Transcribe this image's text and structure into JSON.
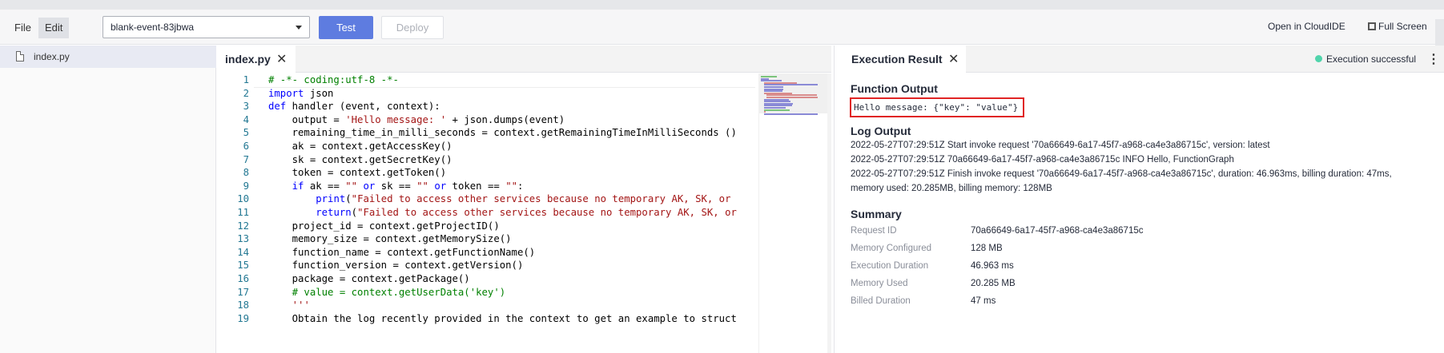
{
  "toolbar": {
    "menu_file": "File",
    "menu_edit": "Edit",
    "function_select_value": "blank-event-83jbwa",
    "test_label": "Test",
    "deploy_label": "Deploy",
    "open_cloudide_label": "Open in CloudIDE",
    "fullscreen_label": "Full Screen"
  },
  "filetree": {
    "items": [
      {
        "label": "index.py",
        "icon": "file-icon"
      }
    ]
  },
  "editor": {
    "tab_label": "index.py",
    "lines": [
      {
        "n": "1",
        "text": "# -*- coding:utf-8 -*-"
      },
      {
        "n": "2",
        "text": "import json"
      },
      {
        "n": "3",
        "text": "def handler (event, context):"
      },
      {
        "n": "4",
        "text": "    output = 'Hello message: ' + json.dumps(event)"
      },
      {
        "n": "5",
        "text": "    remaining_time_in_milli_seconds = context.getRemainingTimeInMilliSeconds ()"
      },
      {
        "n": "6",
        "text": "    ak = context.getAccessKey()"
      },
      {
        "n": "7",
        "text": "    sk = context.getSecretKey()"
      },
      {
        "n": "8",
        "text": "    token = context.getToken()"
      },
      {
        "n": "9",
        "text": "    if ak == \"\" or sk == \"\" or token == \"\":"
      },
      {
        "n": "10",
        "text": "        print(\"Failed to access other services because no temporary AK, SK, or"
      },
      {
        "n": "11",
        "text": "        return(\"Failed to access other services because no temporary AK, SK, or"
      },
      {
        "n": "12",
        "text": "    project_id = context.getProjectID()"
      },
      {
        "n": "13",
        "text": "    memory_size = context.getMemorySize()"
      },
      {
        "n": "14",
        "text": "    function_name = context.getFunctionName()"
      },
      {
        "n": "15",
        "text": "    function_version = context.getVersion()"
      },
      {
        "n": "16",
        "text": "    package = context.getPackage()"
      },
      {
        "n": "17",
        "text": "    # value = context.getUserData('key')"
      },
      {
        "n": "18",
        "text": "    '''"
      },
      {
        "n": "19",
        "text": "    Obtain the log recently provided in the context to get an example to struct"
      }
    ]
  },
  "result": {
    "tab_label": "Execution Result",
    "status_text": "Execution successful",
    "status_color": "#50d4ab",
    "function_output_title": "Function Output",
    "function_output_value": "Hello message: {\"key\": \"value\"}",
    "log_output_title": "Log Output",
    "log_lines": [
      "2022-05-27T07:29:51Z Start invoke request '70a66649-6a17-45f7-a968-ca4e3a86715c', version: latest",
      "2022-05-27T07:29:51Z 70a66649-6a17-45f7-a968-ca4e3a86715c INFO Hello, FunctionGraph",
      "2022-05-27T07:29:51Z Finish invoke request '70a66649-6a17-45f7-a968-ca4e3a86715c', duration: 46.963ms, billing duration: 47ms,",
      "memory used: 20.285MB, billing memory: 128MB"
    ],
    "summary_title": "Summary",
    "summary": [
      {
        "label": "Request ID",
        "value": "70a66649-6a17-45f7-a968-ca4e3a86715c"
      },
      {
        "label": "Memory Configured",
        "value": "128 MB"
      },
      {
        "label": "Execution Duration",
        "value": "46.963 ms"
      },
      {
        "label": "Memory Used",
        "value": "20.285 MB"
      },
      {
        "label": "Billed Duration",
        "value": "47 ms"
      }
    ]
  }
}
